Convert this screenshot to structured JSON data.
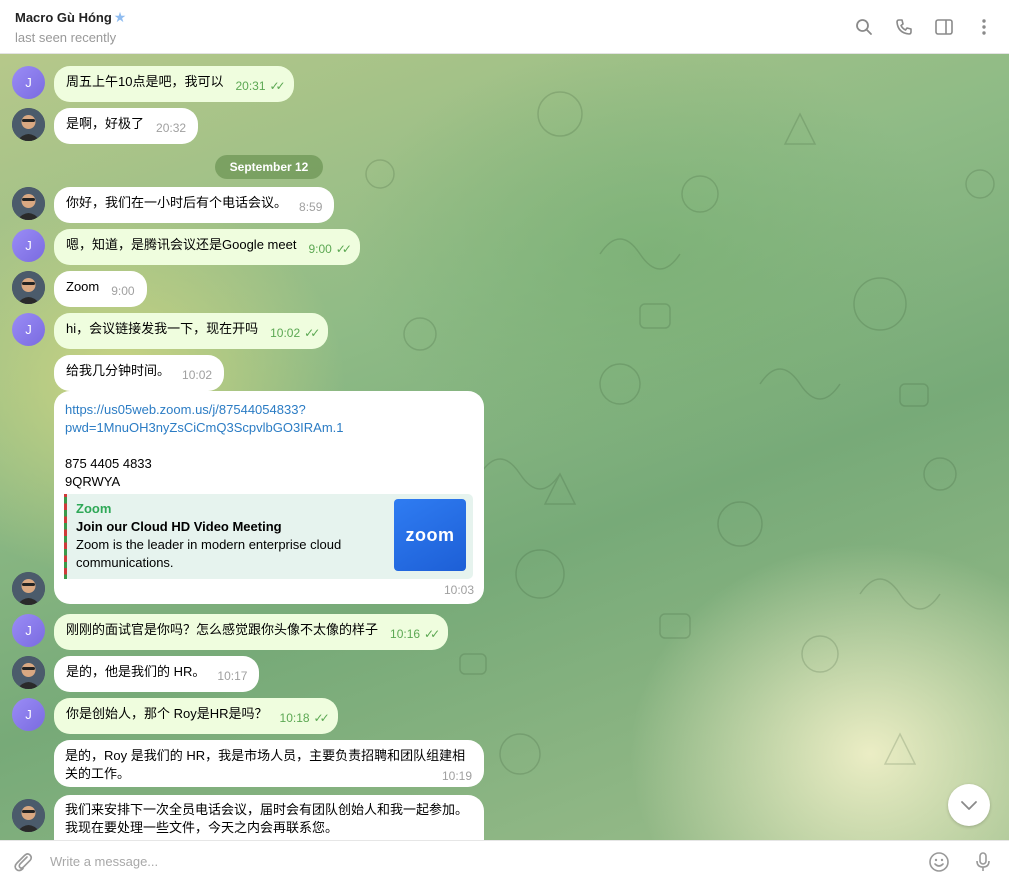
{
  "header": {
    "name": "Macro Gù Hóng",
    "status": "last seen recently",
    "verified_icon": "star-icon",
    "icons": [
      "search-icon",
      "phone-icon",
      "sidebar-icon",
      "more-vertical-icon"
    ]
  },
  "date_separator": "September 12",
  "messages": [
    {
      "id": "m1",
      "from": "J",
      "text": "周五上午10点是吧，我可以",
      "time": "20:31",
      "mine": true
    },
    {
      "id": "m2",
      "from": "macro",
      "text": "是啊，好极了",
      "time": "20:32",
      "mine": false
    },
    {
      "id": "m3",
      "from": "macro",
      "text": "你好，我们在一小时后有个电话会议。",
      "time": "8:59",
      "mine": false
    },
    {
      "id": "m4",
      "from": "J",
      "text": "嗯，知道，是腾讯会议还是Google meet",
      "time": "9:00",
      "mine": true
    },
    {
      "id": "m5",
      "from": "macro",
      "text": "Zoom",
      "time": "9:00",
      "mine": false
    },
    {
      "id": "m6",
      "from": "J",
      "text": "hi，会议链接发我一下，现在开吗",
      "time": "10:02",
      "mine": true
    },
    {
      "id": "m7",
      "from": "macro",
      "text": "给我几分钟时间。",
      "time": "10:02",
      "mine": false
    },
    {
      "id": "m9",
      "from": "J",
      "text": "刚刚的面试官是你吗？怎么感觉跟你头像不太像的样子",
      "time": "10:16",
      "mine": true
    },
    {
      "id": "m10",
      "from": "macro",
      "text": "是的，他是我们的 HR。",
      "time": "10:17",
      "mine": false
    },
    {
      "id": "m11",
      "from": "J",
      "text": "你是创始人，那个 Roy是HR是吗？",
      "time": "10:18",
      "mine": true
    },
    {
      "id": "m12",
      "from": "macro",
      "text_line1": "是的，Roy 是我们的 HR，我是市场人员，主要负责招聘和团队组建相",
      "text_line2": "关的工作。",
      "time": "10:19",
      "mine": false
    },
    {
      "id": "m13",
      "from": "macro",
      "text_line1": "我们来安排下一次全员电话会议，届时会有团队创始人和我一起参加。",
      "text_line2": "我现在要处理一些文件，今天之内会再联系您。",
      "mine": false
    }
  ],
  "zoom_message": {
    "link_line1": "https://us05web.zoom.us/j/87544054833?",
    "link_line2": "pwd=1MnuOH3nyZsCiCmQ3ScpvlbGO3IRAm.1",
    "meeting_id": "875 4405 4833",
    "passcode": "9QRWYA",
    "preview_site": "Zoom",
    "preview_title": "Join our Cloud HD Video Meeting",
    "preview_desc_line1": "Zoom is the leader in modern enterprise cloud",
    "preview_desc_line2": "communications.",
    "logo_text": "zoom",
    "time": "10:03"
  },
  "avatar_letter": "J",
  "composer": {
    "placeholder": "Write a message..."
  },
  "colors": {
    "own_bubble": "#effdde",
    "tick_green": "#5ca853",
    "link": "#2b7cc4",
    "zoom_blue": "#2f7cf2"
  }
}
